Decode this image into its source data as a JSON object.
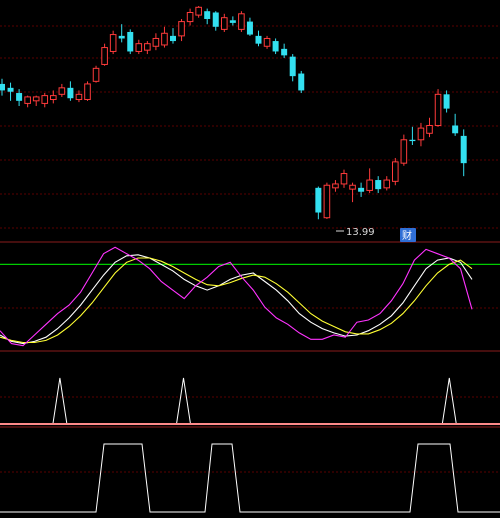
{
  "colors": {
    "background": "#000000",
    "grid": "#5a0000",
    "panel_border": "#8a1c1c",
    "up": "#ff3b3b",
    "down": "#33e0f0",
    "k_line": "#ffffff",
    "d_line": "#ffff33",
    "j_line": "#ff33ff",
    "ref_line": "#00cc00",
    "signal": "#ffffff",
    "badge_bg": "#2f6fd6"
  },
  "labels": {
    "low_price": "13.99",
    "badge": "财"
  },
  "chart_data": [
    {
      "type": "candlestick",
      "ylim": [
        13.5,
        22.2
      ],
      "candles": [
        {
          "o": 19.2,
          "h": 19.4,
          "l": 18.75,
          "c": 18.95
        },
        {
          "o": 19.05,
          "h": 19.25,
          "l": 18.55,
          "c": 18.9
        },
        {
          "o": 18.85,
          "h": 19.0,
          "l": 18.35,
          "c": 18.55
        },
        {
          "o": 18.45,
          "h": 18.75,
          "l": 18.3,
          "c": 18.7
        },
        {
          "o": 18.55,
          "h": 18.75,
          "l": 18.35,
          "c": 18.7
        },
        {
          "o": 18.45,
          "h": 18.85,
          "l": 18.3,
          "c": 18.75
        },
        {
          "o": 18.6,
          "h": 18.95,
          "l": 18.45,
          "c": 18.75
        },
        {
          "o": 18.8,
          "h": 19.2,
          "l": 18.7,
          "c": 19.05
        },
        {
          "o": 19.05,
          "h": 19.3,
          "l": 18.55,
          "c": 18.65
        },
        {
          "o": 18.6,
          "h": 18.95,
          "l": 18.5,
          "c": 18.8
        },
        {
          "o": 18.6,
          "h": 19.3,
          "l": 18.55,
          "c": 19.2
        },
        {
          "o": 19.3,
          "h": 19.9,
          "l": 19.25,
          "c": 19.8
        },
        {
          "o": 19.95,
          "h": 20.75,
          "l": 19.9,
          "c": 20.6
        },
        {
          "o": 20.45,
          "h": 21.25,
          "l": 20.35,
          "c": 21.1
        },
        {
          "o": 21.05,
          "h": 21.5,
          "l": 20.8,
          "c": 20.95
        },
        {
          "o": 21.2,
          "h": 21.3,
          "l": 20.35,
          "c": 20.45
        },
        {
          "o": 20.45,
          "h": 20.9,
          "l": 20.35,
          "c": 20.75
        },
        {
          "o": 20.5,
          "h": 20.85,
          "l": 20.35,
          "c": 20.75
        },
        {
          "o": 20.65,
          "h": 21.15,
          "l": 20.5,
          "c": 20.95
        },
        {
          "o": 20.7,
          "h": 21.4,
          "l": 20.6,
          "c": 21.15
        },
        {
          "o": 21.05,
          "h": 21.35,
          "l": 20.75,
          "c": 20.85
        },
        {
          "o": 21.05,
          "h": 21.7,
          "l": 20.85,
          "c": 21.6
        },
        {
          "o": 21.6,
          "h": 22.1,
          "l": 21.45,
          "c": 21.95
        },
        {
          "o": 21.85,
          "h": 22.2,
          "l": 21.75,
          "c": 22.15
        },
        {
          "o": 22.0,
          "h": 22.1,
          "l": 21.5,
          "c": 21.7
        },
        {
          "o": 21.95,
          "h": 22.0,
          "l": 21.25,
          "c": 21.4
        },
        {
          "o": 21.3,
          "h": 21.9,
          "l": 21.2,
          "c": 21.75
        },
        {
          "o": 21.65,
          "h": 21.8,
          "l": 21.45,
          "c": 21.55
        },
        {
          "o": 21.3,
          "h": 22.0,
          "l": 21.2,
          "c": 21.9
        },
        {
          "o": 21.6,
          "h": 21.75,
          "l": 21.05,
          "c": 21.1
        },
        {
          "o": 21.05,
          "h": 21.25,
          "l": 20.65,
          "c": 20.75
        },
        {
          "o": 20.65,
          "h": 21.05,
          "l": 20.55,
          "c": 20.95
        },
        {
          "o": 20.85,
          "h": 20.95,
          "l": 20.35,
          "c": 20.45
        },
        {
          "o": 20.55,
          "h": 20.75,
          "l": 20.2,
          "c": 20.3
        },
        {
          "o": 20.25,
          "h": 20.35,
          "l": 19.3,
          "c": 19.5
        },
        {
          "o": 19.6,
          "h": 19.7,
          "l": 18.85,
          "c": 18.95
        },
        null,
        {
          "o": 15.2,
          "h": 15.25,
          "l": 13.99,
          "c": 14.25
        },
        {
          "o": 14.05,
          "h": 15.4,
          "l": 14.0,
          "c": 15.3
        },
        {
          "o": 15.2,
          "h": 15.5,
          "l": 15.05,
          "c": 15.35
        },
        {
          "o": 15.35,
          "h": 15.9,
          "l": 15.2,
          "c": 15.75
        },
        {
          "o": 15.15,
          "h": 15.4,
          "l": 14.65,
          "c": 15.3
        },
        {
          "o": 15.2,
          "h": 15.4,
          "l": 14.85,
          "c": 15.05
        },
        {
          "o": 15.1,
          "h": 15.95,
          "l": 15.0,
          "c": 15.5
        },
        {
          "o": 15.5,
          "h": 15.65,
          "l": 15.0,
          "c": 15.15
        },
        {
          "o": 15.2,
          "h": 15.65,
          "l": 15.1,
          "c": 15.5
        },
        {
          "o": 15.45,
          "h": 16.35,
          "l": 15.3,
          "c": 16.2
        },
        {
          "o": 16.15,
          "h": 17.25,
          "l": 16.05,
          "c": 17.05
        },
        {
          "o": 17.05,
          "h": 17.55,
          "l": 16.85,
          "c": 17.0
        },
        {
          "o": 17.05,
          "h": 17.7,
          "l": 16.8,
          "c": 17.5
        },
        {
          "o": 17.3,
          "h": 17.9,
          "l": 17.15,
          "c": 17.6
        },
        {
          "o": 17.6,
          "h": 19.0,
          "l": 17.55,
          "c": 18.8
        },
        {
          "o": 18.8,
          "h": 18.95,
          "l": 18.1,
          "c": 18.25
        },
        {
          "o": 17.6,
          "h": 18.05,
          "l": 17.2,
          "c": 17.3
        },
        {
          "o": 17.2,
          "h": 17.45,
          "l": 15.65,
          "c": 16.15
        }
      ]
    },
    {
      "type": "line",
      "ylim": [
        0,
        100
      ],
      "reference_level": 80,
      "series": [
        {
          "color": "#ffffff",
          "values": [
            14,
            8,
            6,
            8,
            12,
            20,
            30,
            42,
            56,
            70,
            82,
            88,
            89,
            86,
            80,
            74,
            66,
            60,
            56,
            60,
            66,
            70,
            72,
            64,
            56,
            46,
            34,
            26,
            20,
            16,
            13,
            14,
            18,
            24,
            32,
            44,
            60,
            76,
            84,
            86,
            82,
            66
          ]
        },
        {
          "color": "#ffff33",
          "values": [
            12,
            9,
            7,
            7,
            9,
            14,
            22,
            32,
            44,
            58,
            72,
            82,
            86,
            86,
            83,
            78,
            72,
            66,
            61,
            60,
            63,
            67,
            70,
            68,
            62,
            54,
            44,
            34,
            27,
            22,
            17,
            15,
            15,
            19,
            25,
            34,
            46,
            60,
            72,
            80,
            84,
            76
          ]
        },
        {
          "color": "#ff33ff",
          "values": [
            18,
            6,
            4,
            14,
            24,
            34,
            42,
            54,
            72,
            90,
            96,
            90,
            84,
            76,
            64,
            56,
            48,
            60,
            68,
            78,
            82,
            68,
            56,
            40,
            30,
            24,
            16,
            10,
            10,
            14,
            12,
            26,
            28,
            34,
            46,
            62,
            84,
            94,
            90,
            86,
            76,
            38
          ]
        }
      ]
    },
    {
      "type": "line",
      "ylim": [
        0,
        1
      ],
      "series": [
        {
          "color": "#ffffff",
          "values": [
            0,
            0,
            0,
            0,
            0,
            0,
            0,
            0,
            0,
            0,
            0,
            0,
            0,
            0,
            0,
            0,
            1,
            0,
            0,
            0,
            0,
            0,
            0,
            0,
            0,
            0,
            0,
            0,
            0,
            0,
            0,
            0,
            0,
            0,
            0,
            0,
            0,
            0,
            0,
            0,
            0,
            0,
            0,
            0,
            0,
            0,
            0,
            0,
            0,
            1,
            0,
            0,
            0,
            0,
            0,
            0,
            0,
            0,
            0,
            0,
            0,
            0,
            0,
            0,
            0,
            0,
            0,
            0,
            0,
            0,
            0,
            0,
            0,
            0,
            0,
            0,
            0,
            0,
            0,
            0,
            0,
            0,
            0,
            0,
            0,
            0,
            0,
            0,
            0,
            0,
            0,
            0,
            0,
            0,
            0,
            0,
            0,
            0,
            0,
            0,
            0,
            0,
            0,
            0,
            0,
            0,
            0,
            0,
            0,
            0,
            0,
            0,
            0,
            0,
            0,
            0,
            0,
            0,
            0,
            0,
            1,
            0,
            0,
            0,
            0,
            0,
            0,
            0,
            0,
            0,
            0,
            0,
            0,
            0
          ]
        }
      ]
    },
    {
      "type": "area",
      "ylim": [
        0,
        1
      ],
      "segments": [
        {
          "rise_start": 96,
          "top_start": 104,
          "top_end": 142,
          "fall_end": 150
        },
        {
          "rise_start": 205,
          "top_start": 212,
          "top_end": 232,
          "fall_end": 240
        },
        {
          "rise_start": 410,
          "top_start": 418,
          "top_end": 450,
          "fall_end": 458
        }
      ]
    }
  ]
}
